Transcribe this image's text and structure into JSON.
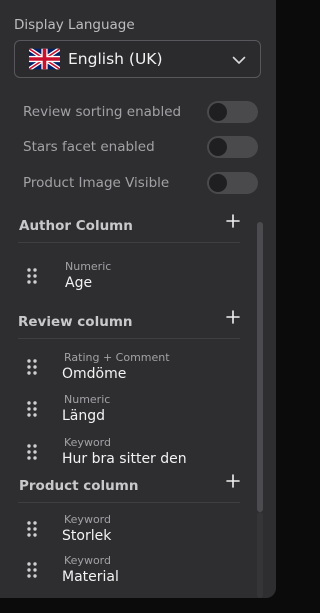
{
  "display_language": {
    "label": "Display Language",
    "selected": "English (UK)",
    "flag_icon": "uk-flag-icon"
  },
  "toggles": [
    {
      "label": "Review sorting enabled",
      "on": false
    },
    {
      "label": "Stars facet enabled",
      "on": false
    },
    {
      "label": "Product Image Visible",
      "on": false
    }
  ],
  "sections": {
    "author": {
      "title": "Author Column",
      "items": [
        {
          "type": "Numeric",
          "name": "Age"
        }
      ]
    },
    "review": {
      "title": "Review column",
      "items": [
        {
          "type": "Rating + Comment",
          "name": "Omdöme"
        },
        {
          "type": "Numeric",
          "name": "Längd"
        },
        {
          "type": "Keyword",
          "name": "Hur bra sitter den"
        }
      ]
    },
    "product": {
      "title": "Product column",
      "items": [
        {
          "type": "Keyword",
          "name": "Storlek"
        },
        {
          "type": "Keyword",
          "name": "Material"
        }
      ]
    }
  },
  "colors": {
    "panel": "#2e2e30",
    "toggle_off": "#4a4a4d",
    "text_primary": "#f2f2f3",
    "text_muted": "#a2a2a6"
  }
}
